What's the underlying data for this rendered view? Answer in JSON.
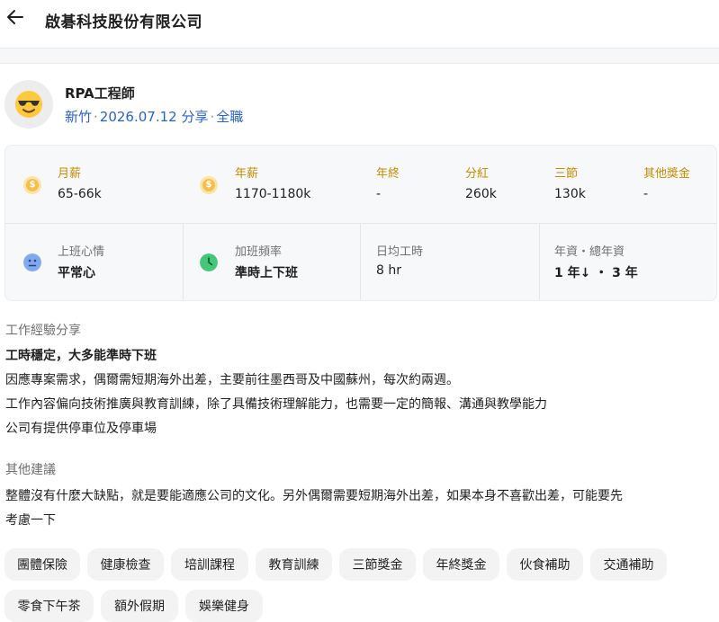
{
  "header": {
    "company": "啟碁科技股份有限公司",
    "back_icon": "arrow-left-icon"
  },
  "job": {
    "avatar_icon": "sunglasses-face-icon",
    "title": "RPA工程師",
    "location": "新竹",
    "date": "2026.07.12 分享",
    "type": "全職"
  },
  "salary": {
    "monthly": {
      "label": "月薪",
      "value": "65-66k"
    },
    "annual": {
      "label": "年薪",
      "value": "1170-1180k"
    },
    "year_end": {
      "label": "年終",
      "value": "-"
    },
    "dividend": {
      "label": "分紅",
      "value": "260k"
    },
    "festival": {
      "label": "三節",
      "value": "130k"
    },
    "other": {
      "label": "其他獎金",
      "value": "-"
    }
  },
  "worklife": {
    "mood": {
      "label": "上班心情",
      "value": "平常心"
    },
    "overtime": {
      "label": "加班頻率",
      "value": "準時上下班"
    },
    "hours": {
      "label": "日均工時",
      "value": "8 hr"
    },
    "tenure": {
      "label": "年資・總年資",
      "value": "1 年↓ ・ 3 年"
    }
  },
  "experience": {
    "heading": "工作經驗分享",
    "lines": [
      "工時穩定，大多能準時下班",
      "因應專案需求，偶爾需短期海外出差，主要前往墨西哥及中國蘇州，每次約兩週。",
      "工作內容偏向技術推廣與教育訓練，除了具備技術理解能力，也需要一定的簡報、溝通與教學能力",
      "公司有提供停車位及停車場"
    ]
  },
  "advice": {
    "heading": "其他建議",
    "lines": [
      "整體沒有什麼大缺點，就是要能適應公司的文化。另外偶爾需要短期海外出差，如果本身不喜歡出差，可能要先",
      "考慮一下"
    ]
  },
  "benefits": [
    "團體保險",
    "健康檢查",
    "培訓課程",
    "教育訓練",
    "三節獎金",
    "年終獎金",
    "伙食補助",
    "交通補助",
    "零食下午茶",
    "額外假期",
    "娛樂健身"
  ],
  "colors": {
    "accent_blue": "#2962c8",
    "gold": "#c58a00",
    "coin": "#f6bf4d",
    "mood_blue": "#7fa8ef",
    "clock_green": "#45c77a"
  }
}
